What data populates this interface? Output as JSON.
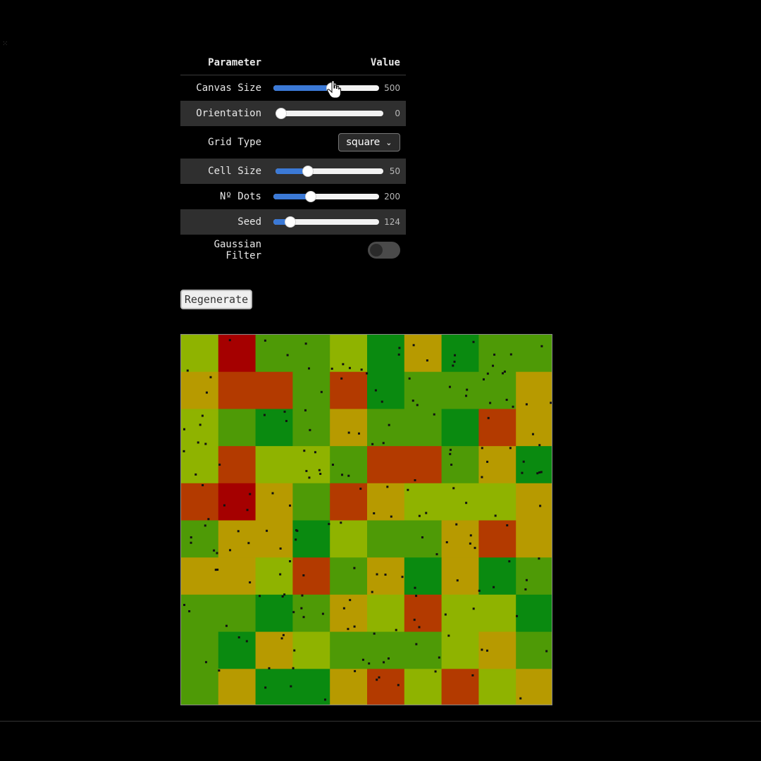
{
  "table": {
    "header_param": "Parameter",
    "header_value": "Value"
  },
  "params": {
    "canvas_size": {
      "label": "Canvas Size",
      "value": "500",
      "fraction": 0.55
    },
    "orientation": {
      "label": "Orientation",
      "value": "0",
      "fraction": 0.0
    },
    "grid_type": {
      "label": "Grid Type",
      "value": "square"
    },
    "cell_size": {
      "label": "Cell Size",
      "value": "50",
      "fraction": 0.3
    },
    "n_dots": {
      "label": "Nº Dots",
      "value": "200",
      "fraction": 0.35
    },
    "seed": {
      "label": "Seed",
      "value": "124",
      "fraction": 0.16
    },
    "gaussian_filter": {
      "label": "Gaussian Filter",
      "enabled": false
    }
  },
  "actions": {
    "regenerate_label": "Regenerate"
  },
  "colors": {
    "accent": "#3b79d6",
    "palette": {
      "R": "#a50000",
      "O": "#b33a00",
      "A": "#b79a00",
      "L": "#8fb300",
      "M": "#4e9a06",
      "G": "#0a8a10"
    },
    "dot": "#111111"
  },
  "grid": {
    "cols": 10,
    "rows": 10,
    "cells": [
      "LRMMLGAGMM",
      "AOOMOGMMMA",
      "LMGMAMMGOA",
      "LOLLMOOMAG",
      "ORAMOALLLA",
      "MAAGLMMAOA",
      "AALOMAGAGM",
      "MMGMALOLLG",
      "MGALMMMLAM",
      "MAGGAOLOLA"
    ]
  }
}
